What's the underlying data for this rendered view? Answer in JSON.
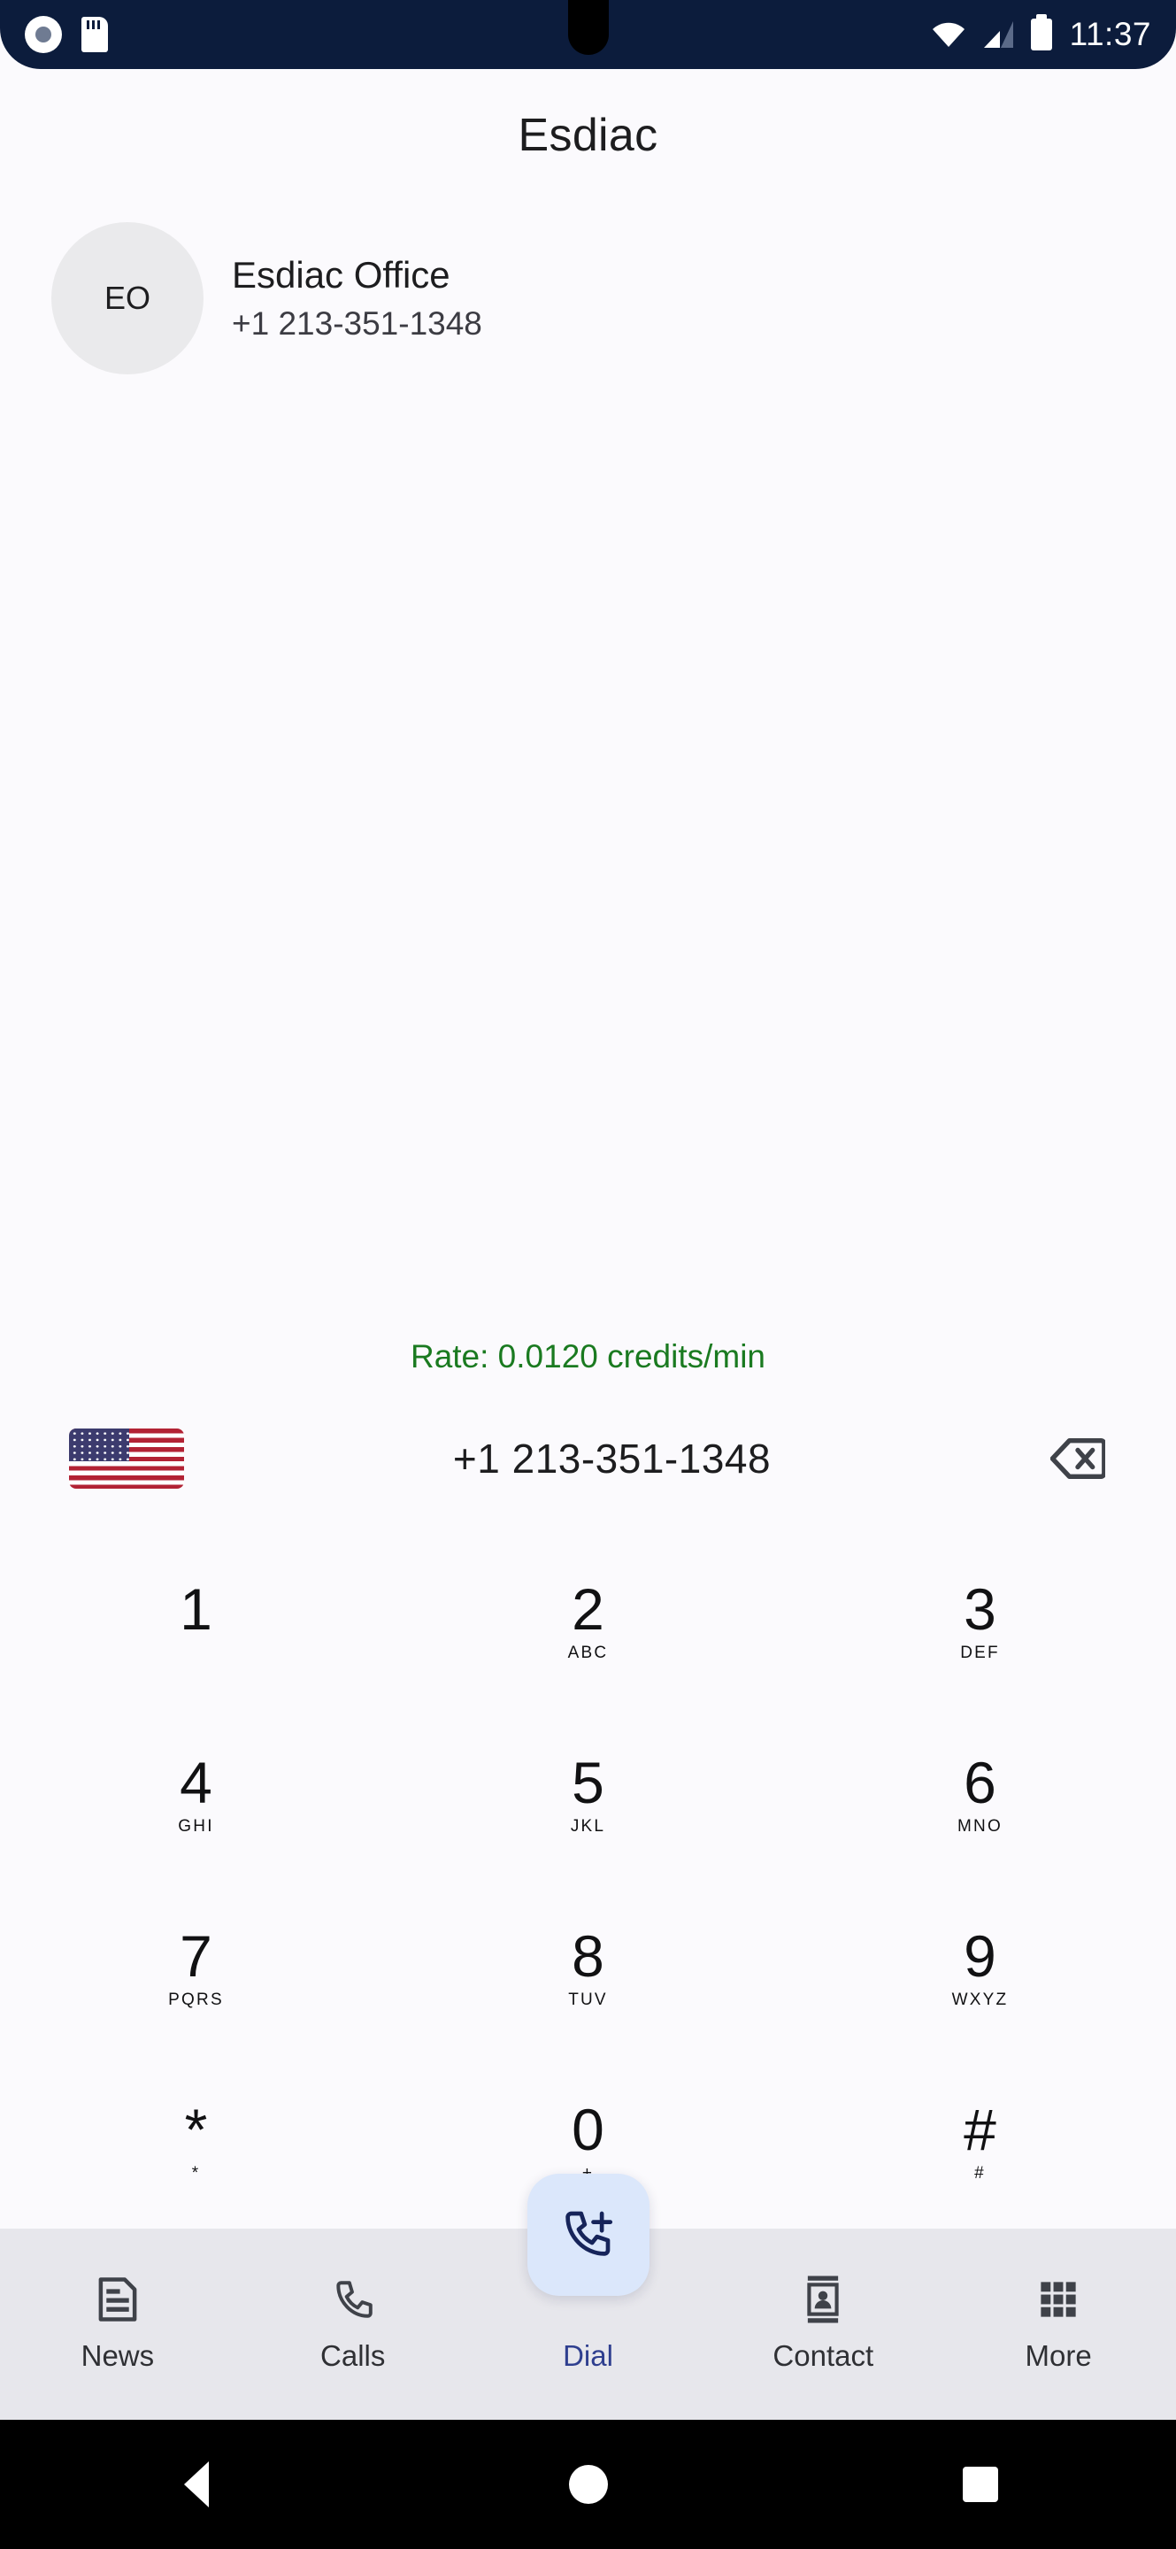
{
  "status_bar": {
    "icons_left": [
      "camera-icon",
      "sdcard-icon"
    ],
    "icons_right": [
      "wifi-icon",
      "signal-icon",
      "battery-icon"
    ],
    "time": "11:37",
    "background_color": "#0c1c3c"
  },
  "header": {
    "title": "Esdiac"
  },
  "contact": {
    "avatar_initials": "EO",
    "name": "Esdiac Office",
    "number": "+1 213-351-1348"
  },
  "rate": {
    "text": "Rate: 0.0120 credits/min",
    "color": "#1a7a20"
  },
  "dial_input": {
    "country_flag": "us-flag-icon",
    "number": "+1 213-351-1348",
    "backspace_icon": "backspace-icon"
  },
  "keypad": {
    "keys": [
      {
        "digit": "1",
        "sub": ""
      },
      {
        "digit": "2",
        "sub": "ABC"
      },
      {
        "digit": "3",
        "sub": "DEF"
      },
      {
        "digit": "4",
        "sub": "GHI"
      },
      {
        "digit": "5",
        "sub": "JKL"
      },
      {
        "digit": "6",
        "sub": "MNO"
      },
      {
        "digit": "7",
        "sub": "PQRS"
      },
      {
        "digit": "8",
        "sub": "TUV"
      },
      {
        "digit": "9",
        "sub": "WXYZ"
      },
      {
        "digit": "*",
        "sub": "*"
      },
      {
        "digit": "0",
        "sub": "+"
      },
      {
        "digit": "#",
        "sub": "#"
      }
    ]
  },
  "call_button": {
    "icon": "phone-add-icon",
    "background_color": "#dbe7fb",
    "icon_color": "#16245a"
  },
  "bottom_nav": {
    "items": [
      {
        "label": "News",
        "icon": "news-document-icon",
        "active": false
      },
      {
        "label": "Calls",
        "icon": "phone-icon",
        "active": false
      },
      {
        "label": "Dial",
        "icon": "dial-icon",
        "active": true
      },
      {
        "label": "Contact",
        "icon": "contact-card-icon",
        "active": false
      },
      {
        "label": "More",
        "icon": "grid-apps-icon",
        "active": false
      }
    ],
    "background_color": "#e7e7ec",
    "active_color": "#2f3f8f"
  },
  "system_nav": {
    "back": "back-triangle-icon",
    "home": "home-circle-icon",
    "recents": "recents-square-icon"
  }
}
